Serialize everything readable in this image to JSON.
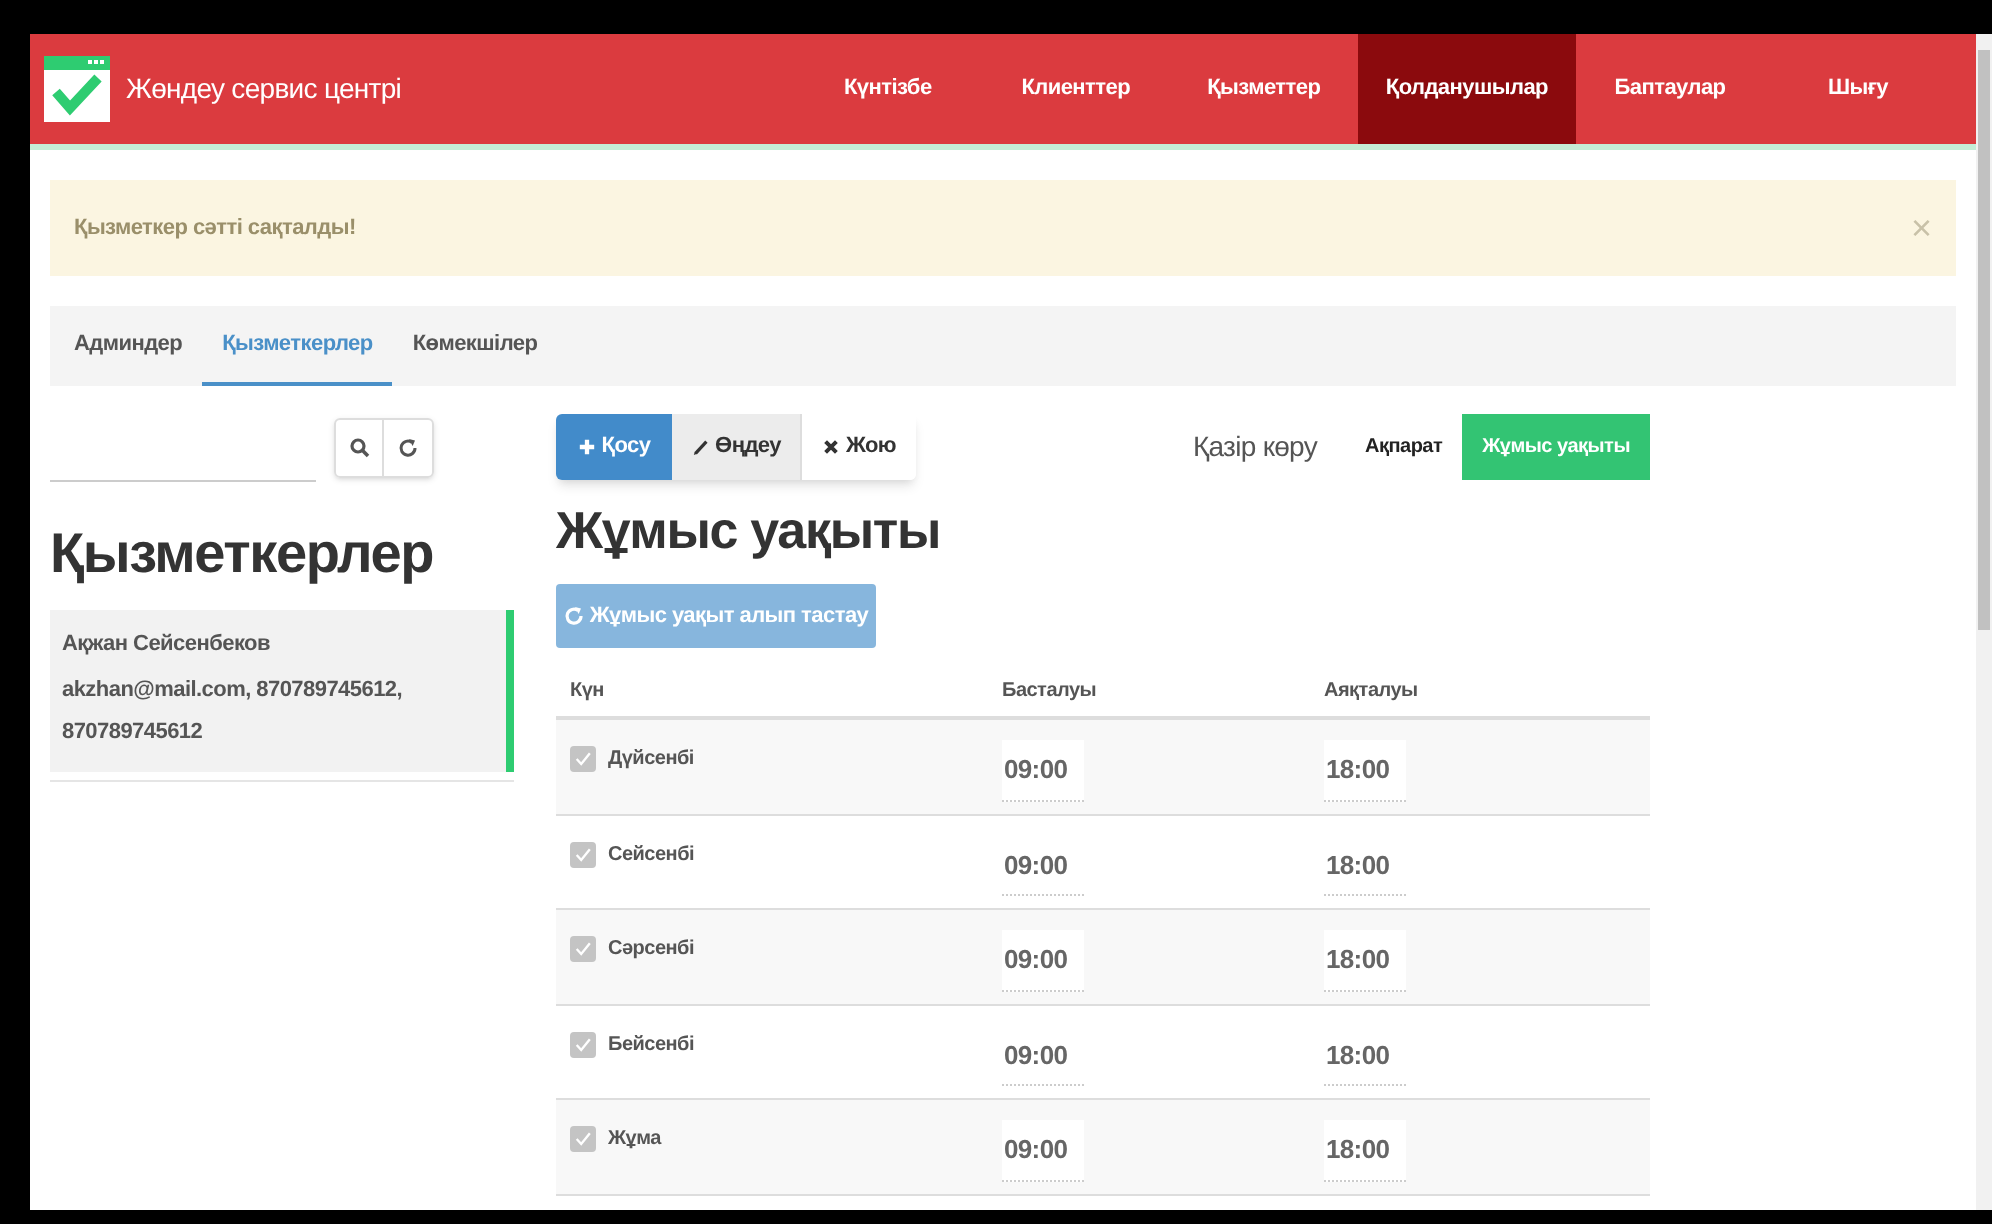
{
  "navbar": {
    "brand": "Жөндеу сервис центрі",
    "items": [
      {
        "label": "Күнтізбе",
        "selected": false
      },
      {
        "label": "Клиенттер",
        "selected": false
      },
      {
        "label": "Қызметтер",
        "selected": false
      },
      {
        "label": "Қолданушылар",
        "selected": true
      },
      {
        "label": "Баптаулар",
        "selected": false
      },
      {
        "label": "Шығу",
        "selected": false
      }
    ]
  },
  "alert": {
    "text": "Қызметкер сәтті сақталды!",
    "close": "×"
  },
  "tabs": [
    {
      "label": "Админдер",
      "selected": false
    },
    {
      "label": "Қызметкерлер",
      "selected": true
    },
    {
      "label": "Көмекшілер",
      "selected": false
    }
  ],
  "sidebar": {
    "heading": "Қызметкерлер",
    "employees": [
      {
        "name": "Ақжан Сейсенбеков",
        "details": "akzhan@mail.com, 870789745612, 870789745612",
        "selected": true
      }
    ]
  },
  "toolbar": [
    {
      "kind": "primary",
      "label": "Қосу"
    },
    {
      "kind": "active",
      "label": "Өңдеу"
    },
    {
      "kind": "plain",
      "label": "Жою"
    }
  ],
  "view": {
    "label": "Қазір көру",
    "options": [
      {
        "label": "Ақпарат",
        "selected": false
      },
      {
        "label": "Жұмыс уақыты",
        "selected": true
      }
    ]
  },
  "title": "Жұмыс уақыты",
  "reset_button": "Жұмыс уақыт алып тастау",
  "table": {
    "columns": [
      "Күн",
      "Басталуы",
      "Аяқталуы"
    ],
    "rows": [
      {
        "checked": true,
        "day": "Дүйсенбі",
        "start": "09:00",
        "end": "18:00"
      },
      {
        "checked": true,
        "day": "Сейсенбі",
        "start": "09:00",
        "end": "18:00"
      },
      {
        "checked": true,
        "day": "Сәрсенбі",
        "start": "09:00",
        "end": "18:00"
      },
      {
        "checked": true,
        "day": "Бейсенбі",
        "start": "09:00",
        "end": "18:00"
      },
      {
        "checked": true,
        "day": "Жұма",
        "start": "09:00",
        "end": "18:00"
      }
    ]
  }
}
